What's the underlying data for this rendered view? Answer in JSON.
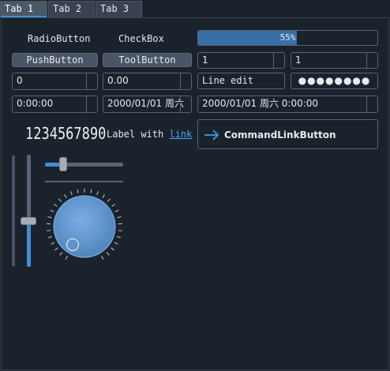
{
  "tabs": [
    {
      "label": "Tab 1",
      "active": true
    },
    {
      "label": "Tab 2",
      "active": false
    },
    {
      "label": "Tab 3",
      "active": false
    }
  ],
  "radio_label": "RadioButton",
  "checkbox_label": "CheckBox",
  "progress": {
    "value": 0.55,
    "text": "55%"
  },
  "push_button": "PushButton",
  "tool_button": "ToolButton",
  "spinbox_a": "1",
  "spinbox_b": "1",
  "spin_int": "0",
  "spin_double": "0.00",
  "line_edit": "Line edit",
  "password_dots": "●●●●●●●●",
  "time_edit": "0:00:00",
  "date_edit": "2000/01/01 周六",
  "datetime_edit": "2000/01/01 周六 0:00:00",
  "lcd_number": "1234567890",
  "label_prefix": "Label with ",
  "label_link": "link",
  "command_link": "CommandLinkButton",
  "h_slider": {
    "value": 0.2
  },
  "v_slider": {
    "value": 0.4
  },
  "colors": {
    "accent": "#3d8fd6",
    "background": "#1a222c",
    "button": "#4a5565"
  }
}
